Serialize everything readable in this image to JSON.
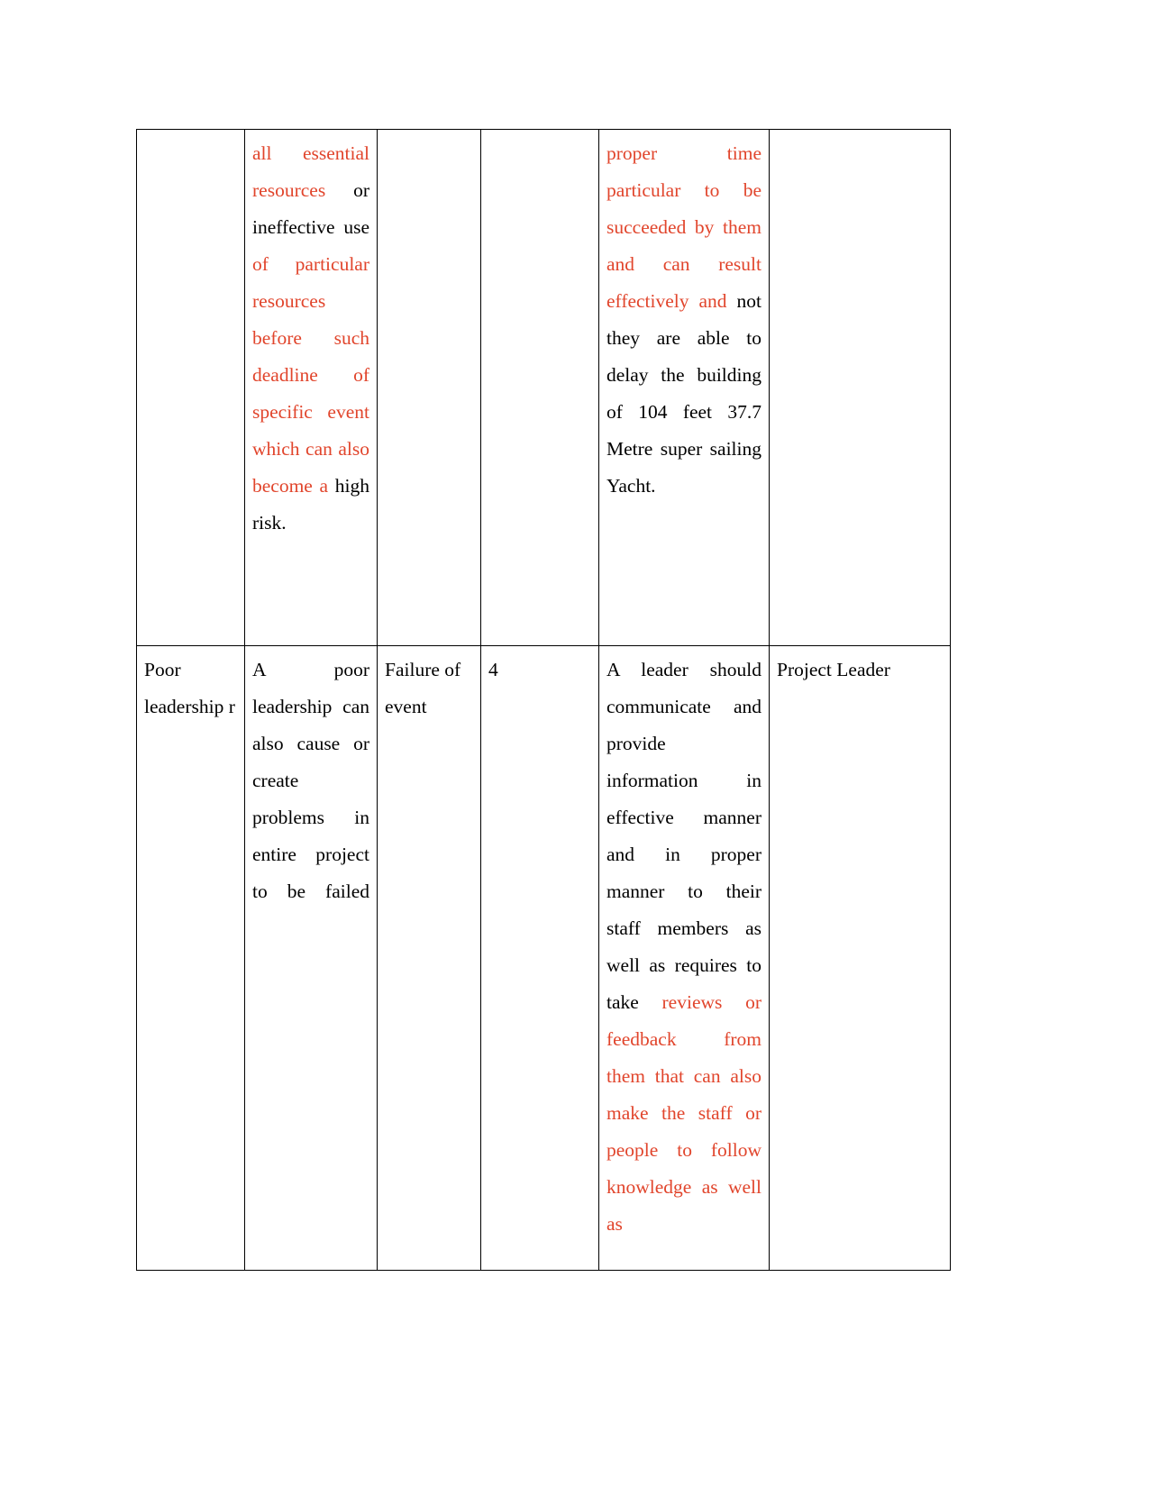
{
  "document": {
    "type": "risk-register-table",
    "page_background": "#ffffff",
    "text_color_default": "#000000",
    "highlight_color": "#E1452C",
    "font_style": "serif",
    "columns": 6
  },
  "table": {
    "rows": [
      {
        "id": "row-continued",
        "continuation": true,
        "cells": {
          "risk_name": "",
          "description_segments": [
            {
              "text": "all essential resources ",
              "color": "#E1452C"
            },
            {
              "text": "or ineffective use ",
              "color": "#000000"
            },
            {
              "text": "of particular resources before such deadline of specific event which can also become a ",
              "color": "#E1452C"
            },
            {
              "text": "high risk.",
              "color": "#000000"
            }
          ],
          "impact": "",
          "rating": "",
          "mitigation_segments": [
            {
              "text": "proper time particular to be succeeded by them and can result effectively and ",
              "color": "#E1452C"
            },
            {
              "text": "not they are able to delay the building of 104 feet 37.7 Metre super sailing Yacht.",
              "color": "#000000"
            }
          ],
          "owner": ""
        }
      },
      {
        "id": "row-poor-leadership",
        "continuation": false,
        "cells": {
          "risk_name": "Poor leadership r",
          "description_segments": [
            {
              "text": "A poor leadership can also cause or create problems in entire project to be failed",
              "color": "#000000"
            }
          ],
          "impact": "Failure of event",
          "rating": "4",
          "mitigation_segments": [
            {
              "text": "A leader should communicate and provide information in effective manner and in proper manner to their staff members as well as requires to take ",
              "color": "#000000"
            },
            {
              "text": "reviews or feedback from them that can also make the staff or people to follow knowledge as well as",
              "color": "#E1452C"
            }
          ],
          "owner": "Project Leader"
        }
      }
    ]
  }
}
